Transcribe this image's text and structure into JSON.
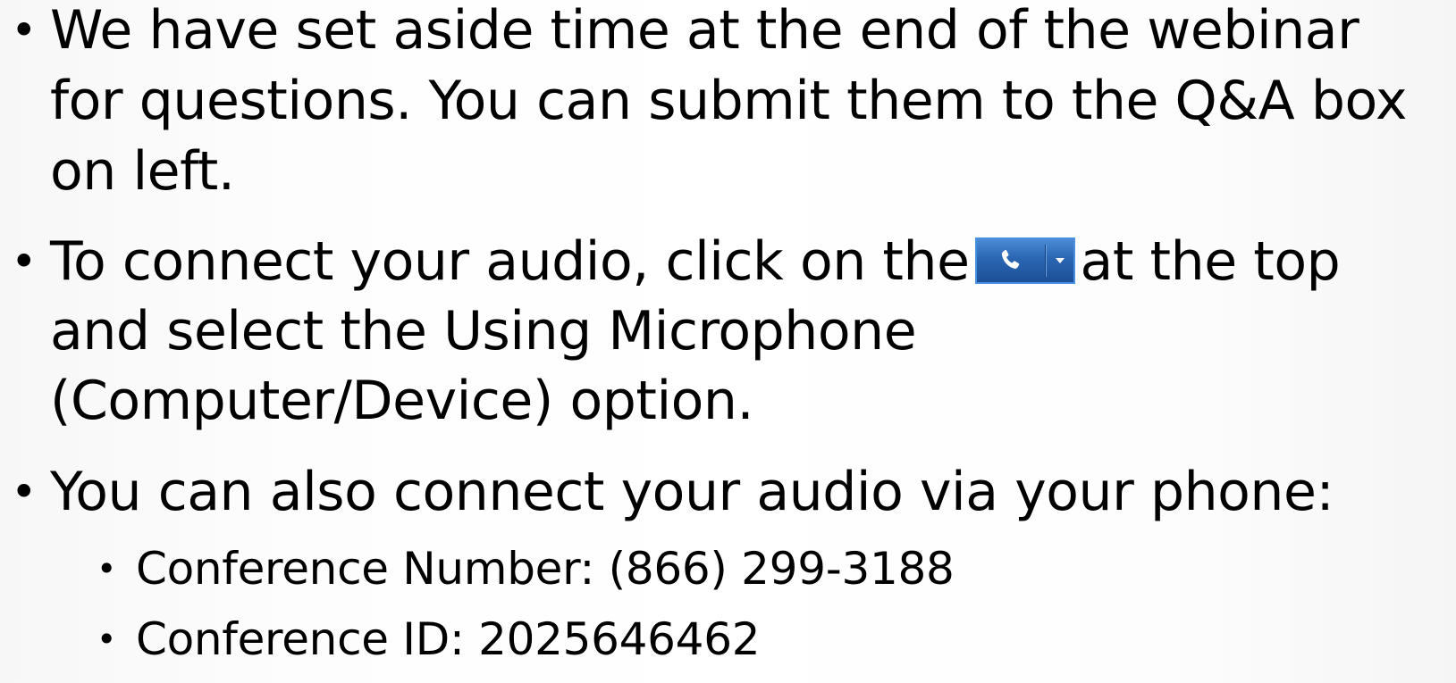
{
  "bullets": [
    {
      "lines": [
        "We have set aside time at the end of the webinar",
        "for questions. You can submit them to the Q&A box",
        "on left."
      ]
    },
    {
      "line1_before": "To connect your audio, click on the",
      "line1_after": "at the top",
      "line2": "and select the Using Microphone",
      "line3": "(Computer/Device) option.",
      "button_icon": "phone-icon",
      "button_arrow": "chevron-down-icon"
    },
    {
      "line": "You can also connect your audio via your phone:",
      "sub_items": [
        "Conference Number: (866) 299-3188",
        "Conference ID: 2025646462"
      ]
    }
  ],
  "bullet_glyph": "•"
}
